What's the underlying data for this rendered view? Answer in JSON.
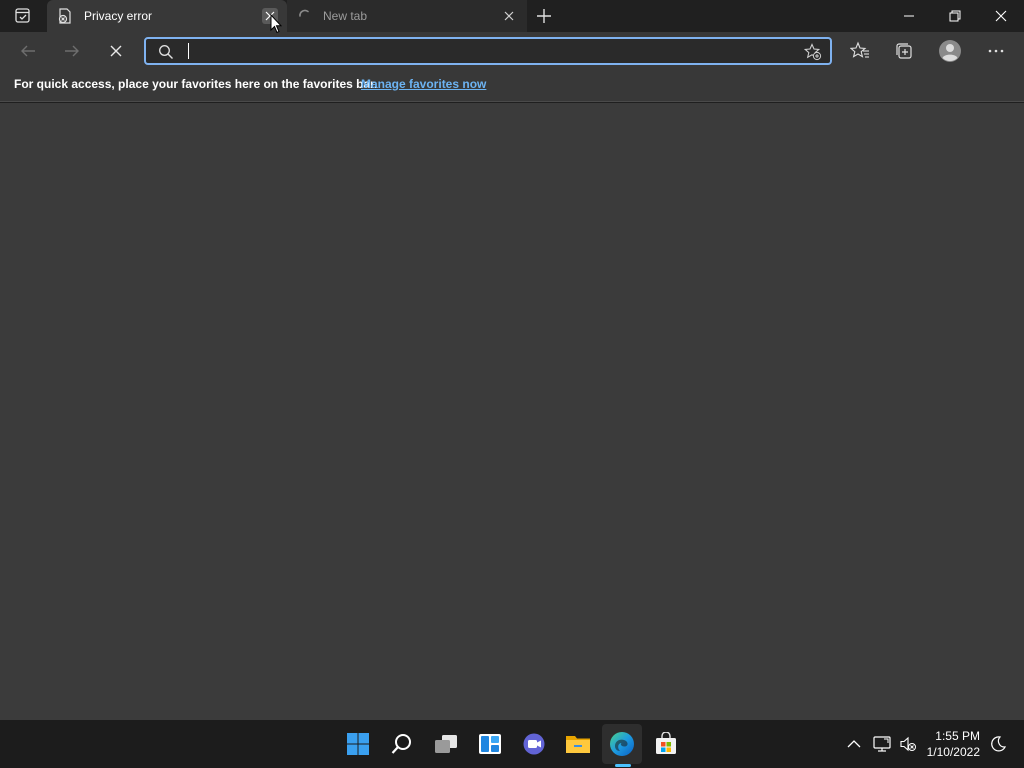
{
  "browser": {
    "tabs": [
      {
        "title": "Privacy error",
        "active": true,
        "favicon": "privacy-error-icon"
      },
      {
        "title": "New tab",
        "active": false,
        "favicon": "loading-icon"
      }
    ],
    "address": {
      "value": "",
      "placeholder": ""
    },
    "favorites_bar": {
      "message": "For quick access, place your favorites here on the favorites bar.",
      "link": "Manage favorites now"
    }
  },
  "taskbar": {
    "apps": [
      "start",
      "search",
      "task-view",
      "widgets",
      "teams-chat",
      "file-explorer",
      "edge",
      "store"
    ],
    "clock": {
      "time": "1:55 PM",
      "date": "1/10/2022"
    }
  },
  "colors": {
    "accent": "#7fb2f0",
    "link": "#6cb3f2",
    "content_bg": "#3b3b3b",
    "taskbar_bg": "#1c1c1c"
  }
}
